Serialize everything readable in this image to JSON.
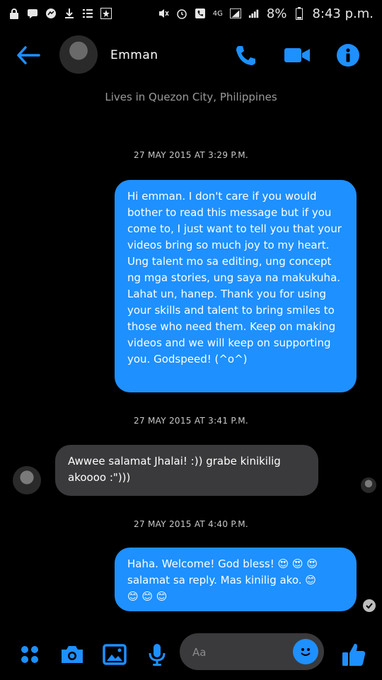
{
  "status_bar": {
    "battery": "8%",
    "time": "8:43 p.m.",
    "network": "4G"
  },
  "header": {
    "contact_name": "Emman"
  },
  "profile": {
    "location": "Lives in Quezon City, Philippines"
  },
  "messages": [
    {
      "type": "timestamp",
      "text": "27 MAY 2015 AT 3:29 P.M."
    },
    {
      "type": "outgoing",
      "text": "Hi emman. I don't care if you would bother to read this message but if you come to, I just want to tell you that your videos bring so much joy to my heart. Ung talent mo sa editing, ung concept ng mga stories, ung saya na makukuha. Lahat un, hanep. Thank you for using your skills and talent to bring smiles to those who need them. Keep on making videos and we will keep on supporting you. Godspeed! (^o^)"
    },
    {
      "type": "timestamp",
      "text": "27 MAY 2015 AT 3:41 P.M."
    },
    {
      "type": "incoming",
      "text": "Awwee salamat Jhalai! :)) grabe kinikilig akoooo :\")))"
    },
    {
      "type": "timestamp",
      "text": "27 MAY 2015 AT 4:40 P.M."
    },
    {
      "type": "outgoing",
      "line1": "Haha. Welcome! God bless! 😍 😍 😍",
      "line2": "salamat sa reply. Mas kinilig ako. 😊",
      "line3": "😊 😊 😊"
    }
  ],
  "composer": {
    "placeholder": "Aa"
  },
  "colors": {
    "accent": "#1e90ff",
    "incoming_bubble": "#3a3a3c",
    "background": "#000000"
  }
}
